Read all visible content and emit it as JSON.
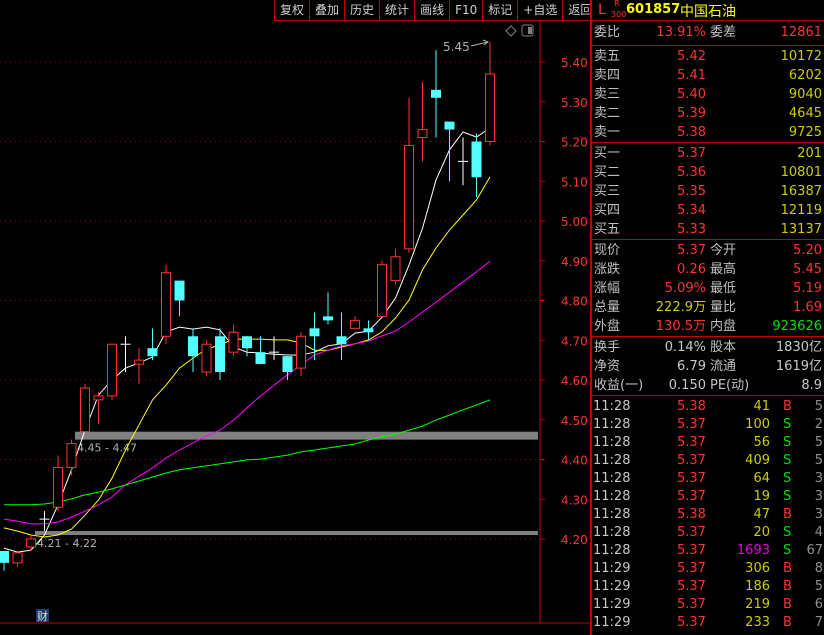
{
  "toolbar": {
    "items": [
      "复权",
      "叠加",
      "历史",
      "统计",
      "画线",
      "F10",
      "标记",
      "+自选",
      "返回"
    ]
  },
  "stock": {
    "prefix": "L",
    "badge_top": "R",
    "badge_bottom": "300",
    "code": "601857",
    "name": "中国石油"
  },
  "order_ratio": {
    "label": "委比",
    "value": "13.91%",
    "diff_label": "委差",
    "diff_value": "12861"
  },
  "asks": [
    {
      "label": "卖五",
      "price": "5.42",
      "volume": "10172"
    },
    {
      "label": "卖四",
      "price": "5.41",
      "volume": "6202"
    },
    {
      "label": "卖三",
      "price": "5.40",
      "volume": "9040"
    },
    {
      "label": "卖二",
      "price": "5.39",
      "volume": "4645"
    },
    {
      "label": "卖一",
      "price": "5.38",
      "volume": "9725"
    }
  ],
  "bids": [
    {
      "label": "买一",
      "price": "5.37",
      "volume": "201"
    },
    {
      "label": "买二",
      "price": "5.36",
      "volume": "10801"
    },
    {
      "label": "买三",
      "price": "5.35",
      "volume": "16387"
    },
    {
      "label": "买四",
      "price": "5.34",
      "volume": "12119"
    },
    {
      "label": "买五",
      "price": "5.33",
      "volume": "13137"
    }
  ],
  "quote": [
    {
      "l1": "现价",
      "v1": "5.37",
      "c1": "red",
      "l2": "今开",
      "v2": "5.20",
      "c2": "red"
    },
    {
      "l1": "涨跌",
      "v1": "0.26",
      "c1": "red",
      "l2": "最高",
      "v2": "5.45",
      "c2": "red"
    },
    {
      "l1": "涨幅",
      "v1": "5.09%",
      "c1": "red",
      "l2": "最低",
      "v2": "5.19",
      "c2": "red"
    },
    {
      "l1": "总量",
      "v1": "222.9万",
      "c1": "yel",
      "l2": "量比",
      "v2": "1.69",
      "c2": "red"
    },
    {
      "l1": "外盘",
      "v1": "130.5万",
      "c1": "red",
      "l2": "内盘",
      "v2": "923626",
      "c2": "grn"
    }
  ],
  "fundamentals": [
    {
      "l1": "换手",
      "v1": "0.14%",
      "l2": "股本",
      "v2": "1830亿"
    },
    {
      "l1": "净资",
      "v1": "6.79",
      "l2": "流通",
      "v2": "1619亿"
    },
    {
      "l1": "收益(一)",
      "v1": "0.150",
      "l2": "PE(动)",
      "v2": "8.9"
    }
  ],
  "ticks": [
    {
      "time": "11:28",
      "price": "5.38",
      "volume": "41",
      "side": "B",
      "count": "5"
    },
    {
      "time": "11:28",
      "price": "5.37",
      "volume": "100",
      "side": "S",
      "count": "2"
    },
    {
      "time": "11:28",
      "price": "5.37",
      "volume": "56",
      "side": "S",
      "count": "5"
    },
    {
      "time": "11:28",
      "price": "5.37",
      "volume": "409",
      "side": "S",
      "count": "5"
    },
    {
      "time": "11:28",
      "price": "5.37",
      "volume": "64",
      "side": "S",
      "count": "3"
    },
    {
      "time": "11:28",
      "price": "5.37",
      "volume": "19",
      "side": "S",
      "count": "3"
    },
    {
      "time": "11:28",
      "price": "5.38",
      "volume": "47",
      "side": "B",
      "count": "3"
    },
    {
      "time": "11:28",
      "price": "5.37",
      "volume": "20",
      "side": "S",
      "count": "4"
    },
    {
      "time": "11:28",
      "price": "5.37",
      "volume": "1693",
      "side": "S",
      "count": "67",
      "large": true
    },
    {
      "time": "11:29",
      "price": "5.37",
      "volume": "306",
      "side": "B",
      "count": "8"
    },
    {
      "time": "11:29",
      "price": "5.37",
      "volume": "186",
      "side": "B",
      "count": "5"
    },
    {
      "time": "11:29",
      "price": "5.37",
      "volume": "219",
      "side": "B",
      "count": "6"
    },
    {
      "time": "11:29",
      "price": "5.37",
      "volume": "233",
      "side": "B",
      "count": "7"
    }
  ],
  "finance_badge": "财",
  "colors": {
    "up": "#ff3232",
    "down": "#54ffff",
    "flat": "#ffffff",
    "ma5": "#ffffff",
    "ma10": "#ffff00",
    "ma20": "#ff00ff",
    "ma60": "#00ff00",
    "zone": "#808080",
    "border": "#c00000"
  },
  "chart_data": {
    "type": "candlestick",
    "ylim": [
      4.1,
      5.47
    ],
    "yticks": [
      "5.40",
      "5.30",
      "5.20",
      "5.10",
      "5.00",
      "4.90",
      "4.80",
      "4.70",
      "4.60",
      "4.50",
      "4.40",
      "4.30",
      "4.20"
    ],
    "grid_dotted_at": [
      5.4,
      5.2,
      5.0,
      4.8,
      4.6,
      4.4,
      4.2
    ],
    "high_annotation": "5.45",
    "zones": [
      {
        "label": "4.45 - 4.47",
        "low": 4.45,
        "high": 4.47
      },
      {
        "label": "4.21 - 4.22",
        "low": 4.21,
        "high": 4.22
      }
    ],
    "candles": [
      [
        4.17,
        4.17,
        4.12,
        4.14
      ],
      [
        4.14,
        4.17,
        4.13,
        4.165
      ],
      [
        4.18,
        4.21,
        4.17,
        4.2
      ],
      [
        4.25,
        4.27,
        4.22,
        4.25
      ],
      [
        4.28,
        4.41,
        4.27,
        4.38
      ],
      [
        4.38,
        4.45,
        4.36,
        4.44
      ],
      [
        4.47,
        4.59,
        4.47,
        4.58
      ],
      [
        4.55,
        4.57,
        4.49,
        4.56
      ],
      [
        4.56,
        4.69,
        4.55,
        4.69
      ],
      [
        4.69,
        4.71,
        4.62,
        4.69
      ],
      [
        4.64,
        4.68,
        4.59,
        4.65
      ],
      [
        4.68,
        4.73,
        4.65,
        4.66
      ],
      [
        4.71,
        4.89,
        4.69,
        4.87
      ],
      [
        4.85,
        4.85,
        4.76,
        4.8
      ],
      [
        4.71,
        4.73,
        4.62,
        4.66
      ],
      [
        4.62,
        4.7,
        4.61,
        4.69
      ],
      [
        4.71,
        4.73,
        4.6,
        4.62
      ],
      [
        4.67,
        4.74,
        4.66,
        4.72
      ],
      [
        4.71,
        4.71,
        4.66,
        4.68
      ],
      [
        4.67,
        4.71,
        4.64,
        4.64
      ],
      [
        4.67,
        4.71,
        4.65,
        4.67
      ],
      [
        4.66,
        4.66,
        4.6,
        4.62
      ],
      [
        4.63,
        4.72,
        4.61,
        4.71
      ],
      [
        4.73,
        4.77,
        4.65,
        4.71
      ],
      [
        4.76,
        4.82,
        4.74,
        4.75
      ],
      [
        4.71,
        4.77,
        4.65,
        4.69
      ],
      [
        4.73,
        4.76,
        4.73,
        4.75
      ],
      [
        4.73,
        4.75,
        4.7,
        4.72
      ],
      [
        4.76,
        4.9,
        4.76,
        4.89
      ],
      [
        4.85,
        4.93,
        4.84,
        4.91
      ],
      [
        4.93,
        5.31,
        4.92,
        5.19
      ],
      [
        5.21,
        5.35,
        5.15,
        5.23
      ],
      [
        5.33,
        5.43,
        5.21,
        5.31
      ],
      [
        5.25,
        5.25,
        5.1,
        5.23
      ],
      [
        5.15,
        5.21,
        5.09,
        5.15
      ],
      [
        5.2,
        5.22,
        5.06,
        5.11
      ],
      [
        5.2,
        5.45,
        5.19,
        5.37
      ]
    ],
    "candle_fields": [
      "open",
      "high",
      "low",
      "close"
    ],
    "series": [
      {
        "key": "ma5",
        "values": [
          4.177,
          4.167,
          4.172,
          4.21,
          4.286,
          4.374,
          4.474,
          4.562,
          4.6,
          4.63,
          4.643,
          4.658,
          4.721,
          4.733,
          4.728,
          4.733,
          4.726,
          4.683,
          4.67,
          4.668,
          4.665,
          4.663,
          4.663,
          4.67,
          4.686,
          4.691,
          4.718,
          4.723,
          4.758,
          4.806,
          4.889,
          4.982,
          5.103,
          5.179,
          5.224,
          5.211,
          5.234
        ]
      },
      {
        "key": "ma10",
        "values": [
          4.228,
          4.22,
          4.21,
          4.205,
          4.21,
          4.225,
          4.26,
          4.298,
          4.353,
          4.424,
          4.487,
          4.55,
          4.587,
          4.63,
          4.655,
          4.678,
          4.688,
          4.703,
          4.703,
          4.703,
          4.701,
          4.701,
          4.693,
          4.675,
          4.675,
          4.683,
          4.691,
          4.701,
          4.721,
          4.756,
          4.801,
          4.877,
          4.932,
          4.977,
          5.015,
          5.053,
          5.111
        ]
      },
      {
        "key": "ma20",
        "values": [
          4.25,
          4.245,
          4.238,
          4.238,
          4.243,
          4.255,
          4.27,
          4.286,
          4.306,
          4.336,
          4.358,
          4.379,
          4.404,
          4.424,
          4.442,
          4.459,
          4.474,
          4.499,
          4.53,
          4.56,
          4.587,
          4.613,
          4.638,
          4.663,
          4.675,
          4.686,
          4.691,
          4.698,
          4.711,
          4.723,
          4.746,
          4.771,
          4.796,
          4.821,
          4.847,
          4.872,
          4.899
        ]
      },
      {
        "key": "ma60",
        "values": [
          4.286,
          4.286,
          4.286,
          4.288,
          4.293,
          4.301,
          4.311,
          4.318,
          4.326,
          4.336,
          4.346,
          4.356,
          4.366,
          4.374,
          4.379,
          4.384,
          4.389,
          4.394,
          4.399,
          4.401,
          4.406,
          4.411,
          4.419,
          4.424,
          4.429,
          4.434,
          4.439,
          4.449,
          4.457,
          4.464,
          4.474,
          4.484,
          4.499,
          4.512,
          4.525,
          4.537,
          4.55
        ]
      }
    ]
  }
}
